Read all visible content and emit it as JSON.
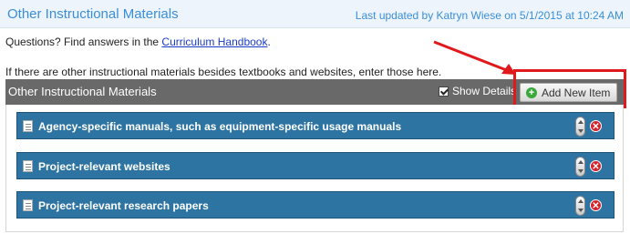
{
  "page": {
    "title": "Other Instructional Materials",
    "last_updated": "Last updated by Katryn Wiese on 5/1/2015 at 10:24 AM"
  },
  "help": {
    "prefix": "Questions? Find answers in the ",
    "link_text": "Curriculum Handbook",
    "suffix": "."
  },
  "instructions": "If there are other instructional materials besides textbooks and websites, enter those here.",
  "section": {
    "title": "Other Instructional Materials",
    "show_details_label": "Show Details",
    "show_details_checked": true,
    "add_button_label": "Add New Item"
  },
  "items": [
    {
      "label": "Agency-specific manuals, such as equipment-specific usage manuals"
    },
    {
      "label": "Project-relevant websites"
    },
    {
      "label": "Project-relevant research papers"
    }
  ],
  "icons": {
    "add": "plus-circle-icon",
    "item": "document-edit-icon",
    "reorder": "up-down-arrow-icon",
    "delete": "close-x-icon"
  },
  "colors": {
    "title_blue": "#3a8ed8",
    "section_gray": "#696969",
    "item_blue": "#2e74a2",
    "highlight_red": "#e0191c",
    "add_green": "#3aa83a",
    "delete_red": "#d4232b"
  }
}
